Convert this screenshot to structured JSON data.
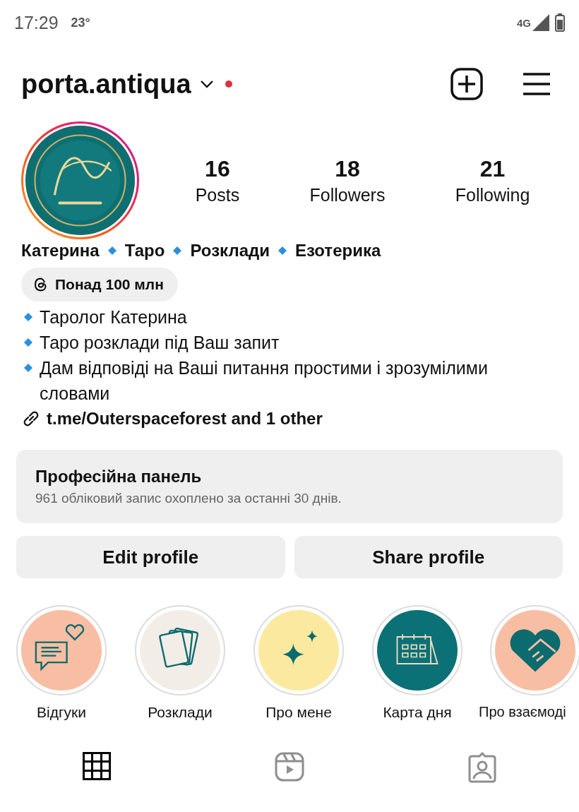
{
  "status_bar": {
    "time": "17:29",
    "temperature": "23°",
    "network": "4G"
  },
  "header": {
    "username": "porta.antiqua",
    "notification_dot": true
  },
  "profile": {
    "avatar": {
      "kind": "picture",
      "story_ring": true
    },
    "stats": [
      {
        "value": "16",
        "label": "Posts"
      },
      {
        "value": "18",
        "label": "Followers"
      },
      {
        "value": "21",
        "label": "Following"
      }
    ],
    "headline": [
      "Катерина",
      "Таро",
      "Розклади",
      "Езотерика"
    ],
    "threads_badge": "Понад 100 млн",
    "bio": [
      "Таролог Катерина",
      "Таро розклади під Ваш запит",
      "Дам відповіді на Ваші питання простими і зрозумілими словами"
    ],
    "link": "t.me/Outerspaceforest and 1 other"
  },
  "pro_panel": {
    "title": "Професійна панель",
    "subtitle": "961 обліковий запис охоплено за останні 30 днів."
  },
  "buttons": [
    "Edit profile",
    "Share profile"
  ],
  "highlights": [
    {
      "label": "Відгуки",
      "kind": "chat",
      "color": "#f8bea3"
    },
    {
      "label": "Розклади",
      "kind": "cards",
      "color": "#f3ede7"
    },
    {
      "label": "Про мене",
      "kind": "sparkle",
      "color": "#fbe9a0"
    },
    {
      "label": "Карта дня",
      "kind": "calendar",
      "color": "#0b7176"
    },
    {
      "label": "Про взаємоді",
      "kind": "handshake",
      "color": "#f8bea3"
    }
  ],
  "tabs": [
    {
      "kind": "grid",
      "selected": true
    },
    {
      "kind": "reels",
      "selected": false
    },
    {
      "kind": "tagged",
      "selected": false
    }
  ]
}
